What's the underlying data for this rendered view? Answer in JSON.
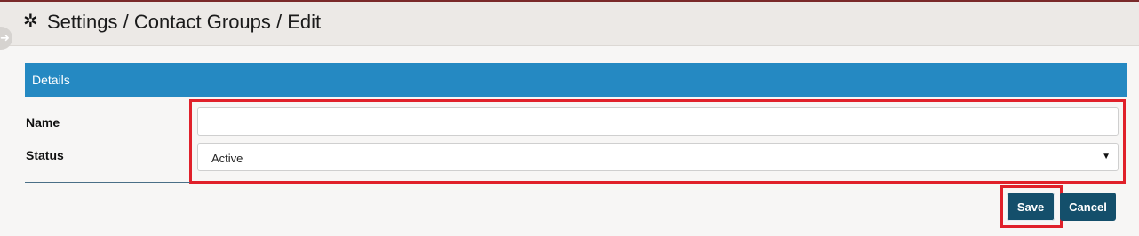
{
  "header": {
    "icon": "gear-icon",
    "title": "Settings / Contact Groups / Edit"
  },
  "side_handle": {
    "icon": "arrow-right-icon"
  },
  "panel": {
    "title": "Details"
  },
  "form": {
    "name_label": "Name",
    "name_value": "",
    "status_label": "Status",
    "status_value": "Active",
    "status_caret_icon": "caret-down-icon"
  },
  "actions": {
    "save_label": "Save",
    "cancel_label": "Cancel"
  },
  "colors": {
    "panel_header": "#2589c2",
    "button": "#144f6b",
    "highlight": "#e0202a"
  }
}
